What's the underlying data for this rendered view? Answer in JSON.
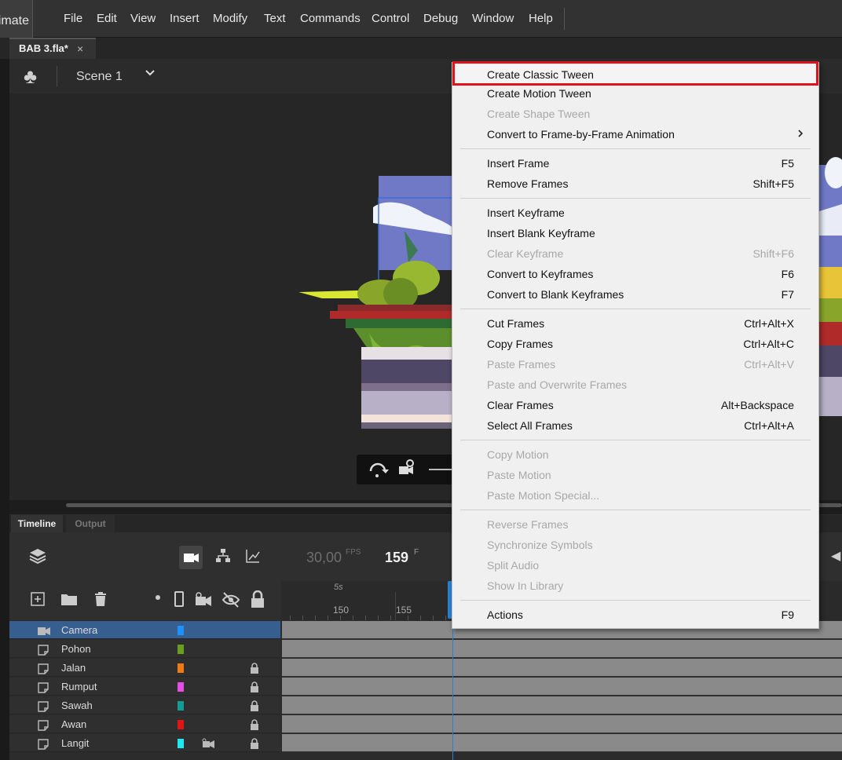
{
  "app": {
    "name_fragment": "imate",
    "document_tab": "BAB 3.fla*",
    "close_glyph": "×"
  },
  "menubar": {
    "items": [
      "File",
      "Edit",
      "View",
      "Insert",
      "Modify",
      "Text",
      "Commands",
      "Control",
      "Debug",
      "Window",
      "Help"
    ]
  },
  "scene": {
    "label": "Scene 1",
    "icon": "club-icon",
    "dropdown_icon": "chevron-down-icon"
  },
  "timeline": {
    "tabs": [
      "Timeline",
      "Output"
    ],
    "fps_value": "30,00",
    "fps_unit": "FPS",
    "current_frame": "159",
    "frame_unit": "F",
    "ruler": {
      "marker": "5s",
      "numbers": [
        "150",
        "155"
      ]
    },
    "layers": [
      {
        "name": "Camera",
        "color": "#1e90ff",
        "selected": true,
        "locked": false,
        "icon": "camera-layer-icon"
      },
      {
        "name": "Pohon",
        "color": "#6a9e1f",
        "selected": false,
        "locked": false,
        "icon": "layer-icon"
      },
      {
        "name": "Jalan",
        "color": "#f07a14",
        "selected": false,
        "locked": true,
        "icon": "layer-icon"
      },
      {
        "name": "Rumput",
        "color": "#e64ee6",
        "selected": false,
        "locked": true,
        "icon": "layer-icon"
      },
      {
        "name": "Sawah",
        "color": "#139c94",
        "selected": false,
        "locked": true,
        "icon": "layer-icon"
      },
      {
        "name": "Awan",
        "color": "#e01414",
        "selected": false,
        "locked": true,
        "icon": "layer-icon"
      },
      {
        "name": "Langit",
        "color": "#1ee8f0",
        "selected": false,
        "locked": true,
        "icon": "layer-icon",
        "camera_attached": true
      }
    ]
  },
  "context_menu": {
    "highlight_color": "#e0121b",
    "groups": [
      [
        {
          "label": "Create Classic Tween",
          "shortcut": "",
          "enabled": true,
          "highlighted": true
        },
        {
          "label": "Create Motion Tween",
          "shortcut": "",
          "enabled": true
        },
        {
          "label": "Create Shape Tween",
          "shortcut": "",
          "enabled": false
        },
        {
          "label": "Convert to Frame-by-Frame Animation",
          "shortcut": "",
          "enabled": true,
          "submenu": true
        }
      ],
      [
        {
          "label": "Insert Frame",
          "shortcut": "F5",
          "enabled": true
        },
        {
          "label": "Remove Frames",
          "shortcut": "Shift+F5",
          "enabled": true
        }
      ],
      [
        {
          "label": "Insert Keyframe",
          "shortcut": "",
          "enabled": true
        },
        {
          "label": "Insert Blank Keyframe",
          "shortcut": "",
          "enabled": true
        },
        {
          "label": "Clear Keyframe",
          "shortcut": "Shift+F6",
          "enabled": false
        },
        {
          "label": "Convert to Keyframes",
          "shortcut": "F6",
          "enabled": true
        },
        {
          "label": "Convert to Blank Keyframes",
          "shortcut": "F7",
          "enabled": true
        }
      ],
      [
        {
          "label": "Cut Frames",
          "shortcut": "Ctrl+Alt+X",
          "enabled": true
        },
        {
          "label": "Copy Frames",
          "shortcut": "Ctrl+Alt+C",
          "enabled": true
        },
        {
          "label": "Paste Frames",
          "shortcut": "Ctrl+Alt+V",
          "enabled": false
        },
        {
          "label": "Paste and Overwrite Frames",
          "shortcut": "",
          "enabled": false
        },
        {
          "label": "Clear Frames",
          "shortcut": "Alt+Backspace",
          "enabled": true
        },
        {
          "label": "Select All Frames",
          "shortcut": "Ctrl+Alt+A",
          "enabled": true
        }
      ],
      [
        {
          "label": "Copy Motion",
          "shortcut": "",
          "enabled": false
        },
        {
          "label": "Paste Motion",
          "shortcut": "",
          "enabled": false
        },
        {
          "label": "Paste Motion Special...",
          "shortcut": "",
          "enabled": false
        }
      ],
      [
        {
          "label": "Reverse Frames",
          "shortcut": "",
          "enabled": false
        },
        {
          "label": "Synchronize Symbols",
          "shortcut": "",
          "enabled": false
        },
        {
          "label": "Split Audio",
          "shortcut": "",
          "enabled": false
        },
        {
          "label": "Show In Library",
          "shortcut": "",
          "enabled": false
        }
      ],
      [
        {
          "label": "Actions",
          "shortcut": "F9",
          "enabled": true
        }
      ]
    ]
  }
}
